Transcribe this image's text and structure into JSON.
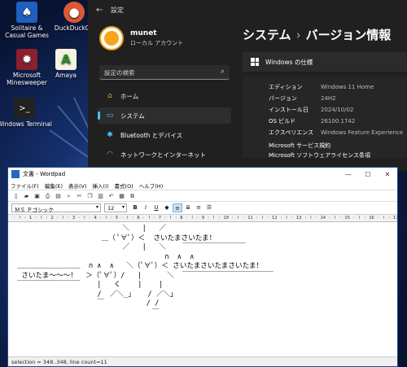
{
  "desktop": {
    "icons": [
      {
        "label": "Solitaire & Casual Games",
        "icon": "cards-icon",
        "color": "#1e5fbf"
      },
      {
        "label": "DuckDuckGo",
        "icon": "duck-icon",
        "color": "#de5833"
      },
      {
        "label": "Microsoft Minesweeper",
        "icon": "mine-icon",
        "color": "#8a2030"
      },
      {
        "label": "Amaya",
        "icon": "amaya-icon",
        "color": "#2a8a2a"
      },
      {
        "label": "Windows Terminal",
        "icon": "terminal-icon",
        "color": "#222222"
      }
    ]
  },
  "settings": {
    "window_title": "設定",
    "user_name": "munet",
    "user_role": "ローカル アカウント",
    "search_placeholder": "設定の検索",
    "nav": [
      {
        "label": "ホーム",
        "icon": "home-icon",
        "active": false
      },
      {
        "label": "システム",
        "icon": "monitor-icon",
        "active": true
      },
      {
        "label": "Bluetooth とデバイス",
        "icon": "bluetooth-icon",
        "active": false
      },
      {
        "label": "ネットワークとインターネット",
        "icon": "wifi-icon",
        "active": false
      }
    ],
    "breadcrumb_parent": "システム",
    "breadcrumb_current": "バージョン情報",
    "spec_card_title": "Windows の仕様",
    "specs": [
      {
        "key": "エディション",
        "value": "Windows 11 Home"
      },
      {
        "key": "バージョン",
        "value": "24H2"
      },
      {
        "key": "インストール日",
        "value": "2024/10/02"
      },
      {
        "key": "OS ビルド",
        "value": "26100.1742"
      },
      {
        "key": "エクスペリエンス",
        "value": "Windows Feature Experience"
      }
    ],
    "links": [
      "Microsoft サービス規約",
      "Microsoft ソフトウェアライセンス条項"
    ]
  },
  "wordpad": {
    "title": "文書 - Wordpad",
    "menus": [
      "ファイル(F)",
      "編集(E)",
      "表示(V)",
      "挿入(I)",
      "書式(O)",
      "ヘルプ(H)"
    ],
    "font_name": "ＭＳ Ｐゴシック",
    "font_size": "12",
    "ruler": "· ! · 1 · ! · 2 · ! · 3 · ! · 4 · ! · 5 · ! · 6 · ! · 7 · ! · 8 · ! · 9 · ! · 10 · ! · 11 · ! · 12 · ! · 13 · ! · 14 · ! · 15 · ! · 16 · ! · 17 ·",
    "content": "                          ＼   |   ／\n                     ＿（ ﾟ∀ﾟ）＜  さいたまさいたま！\n                          ／   |   ＼    ￣￣￣￣￣￣￣￣￣\n                                    ∩  ∧  ∧\n ＿＿＿＿＿＿＿＿＿  ∩ ∧  ∧   ＼（ﾟ∀ﾟ）＜ さいたまさいたまさいたま！\n  さいたま～～～！  ＞（ﾟ∀ﾟ）/   |      ＼  ￣￣￣￣￣￣￣￣￣￣￣￣￣\n ￣￣￣￣￣￣￣￣￣    |   く    |    |\n                    /  ／＼_」   / ／＼」\n                    ￣          / /\n                                 ￣",
    "status": "selection = 348..348, line count=11"
  }
}
